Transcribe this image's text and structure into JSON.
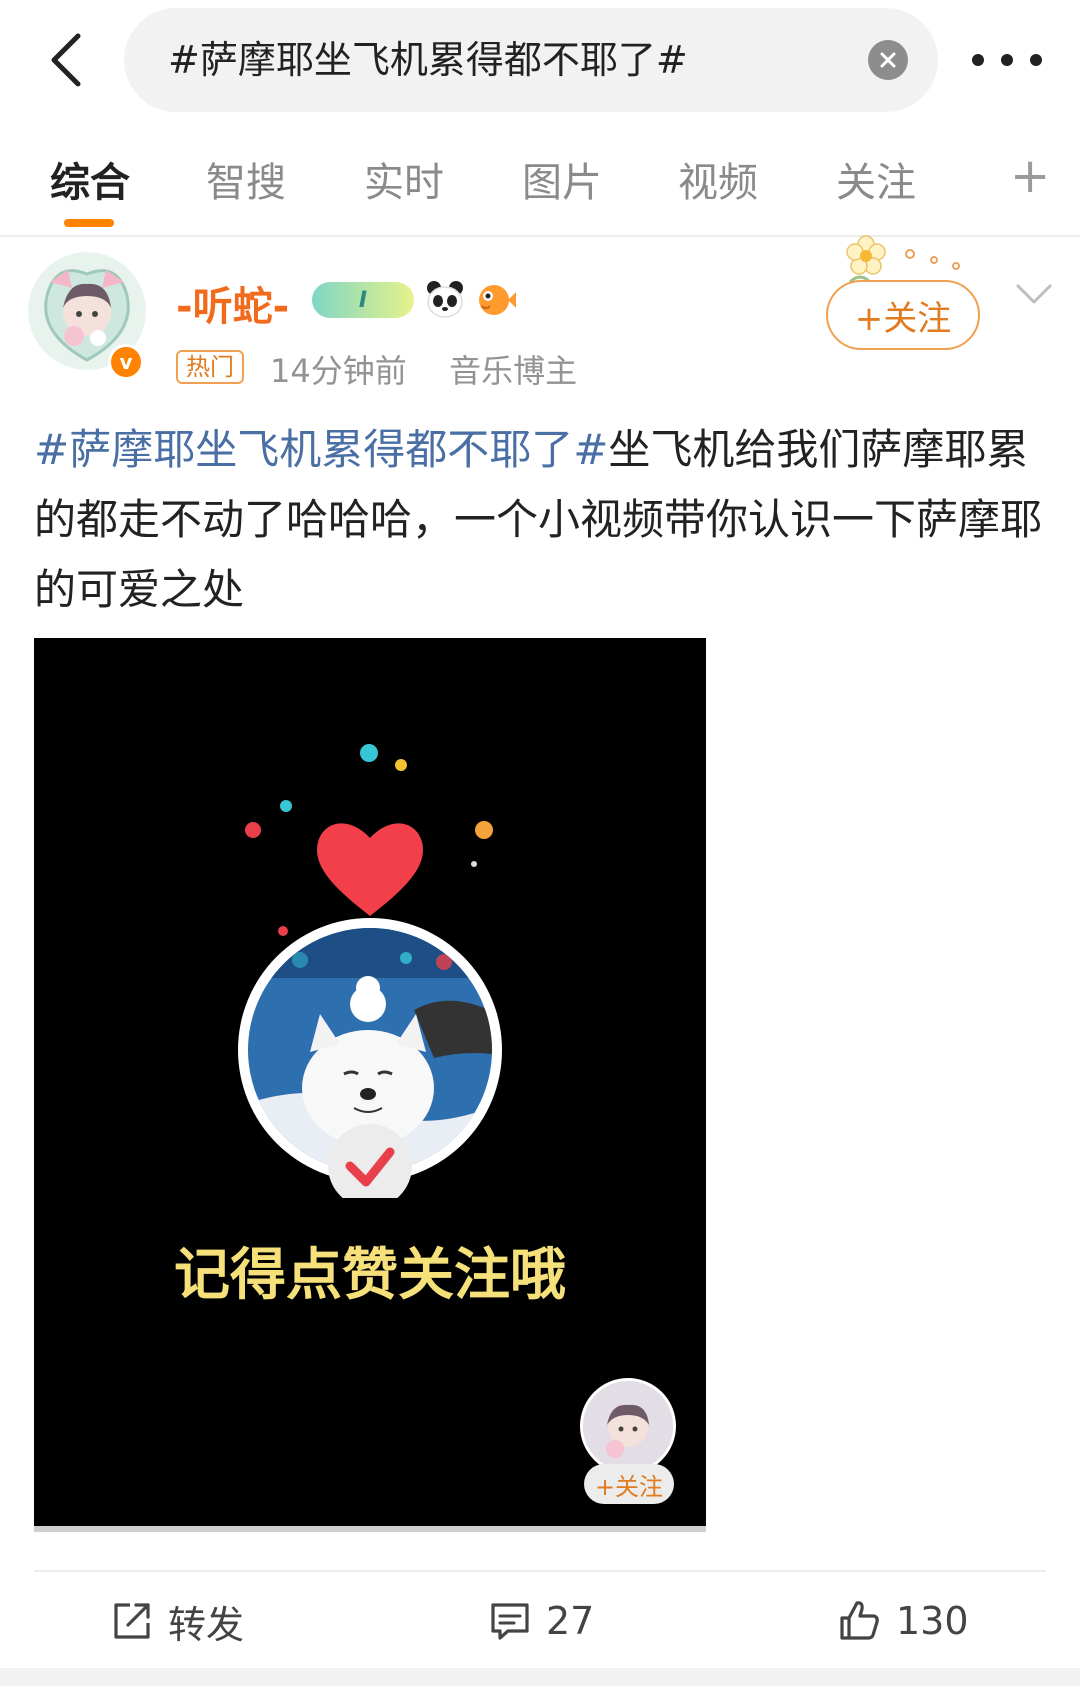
{
  "search": {
    "query": "#萨摩耶坐飞机累得都不耶了#"
  },
  "tabs": [
    {
      "label": "综合"
    },
    {
      "label": "智搜"
    },
    {
      "label": "实时"
    },
    {
      "label": "图片"
    },
    {
      "label": "视频"
    },
    {
      "label": "关注"
    }
  ],
  "tabs_add": "+",
  "post": {
    "author": "-听蛇-",
    "level": "I",
    "hot_tag": "热门",
    "time": "14分钟前",
    "author_title": "音乐博主",
    "follow_label": "+关注",
    "hashtag": "#萨摩耶坐飞机累得都不耶了#",
    "text": "坐飞机给我们萨摩耶累的都走不动了哈哈哈，一个小视频带你认识一下萨摩耶的可爱之处",
    "video": {
      "caption": "记得点赞关注哦",
      "follow_label": "+关注"
    }
  },
  "actions": {
    "repost_label": "转发",
    "comment_count": "27",
    "like_count": "130"
  },
  "colors": {
    "accent": "#ff8200",
    "username": "#f26b1c",
    "hashtag": "#4a6fa5"
  }
}
